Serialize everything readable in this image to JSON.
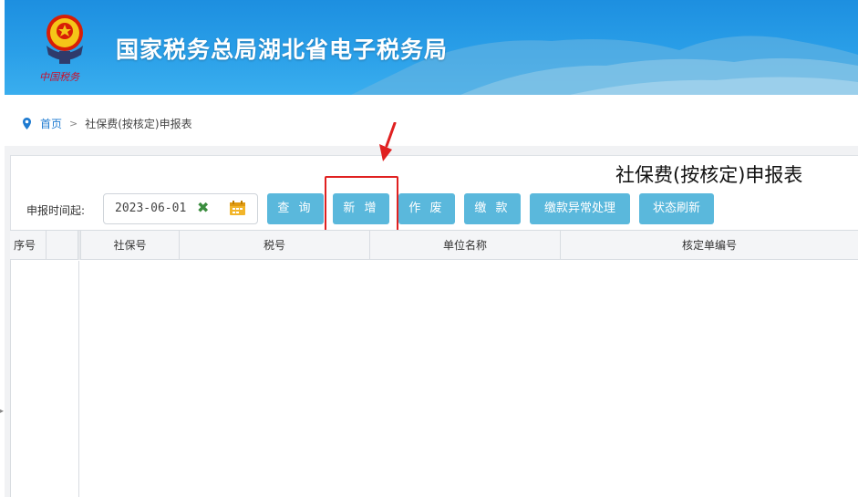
{
  "header": {
    "site_title": "国家税务总局湖北省电子税务局",
    "slogan": "中国税务"
  },
  "breadcrumb": {
    "home": "首页",
    "separator": ">",
    "current": "社保费(按核定)申报表"
  },
  "form": {
    "title": "社保费(按核定)申报表",
    "date_label": "申报时间起:",
    "date_value": "2023-06-01"
  },
  "toolbar": {
    "query": "查 询",
    "add": "新 增",
    "void": "作 废",
    "pay": "缴 款",
    "payment_exception": "缴款异常处理",
    "status_refresh": "状态刷新"
  },
  "table": {
    "columns": [
      "序号",
      "",
      "社保号",
      "税号",
      "单位名称",
      "核定单编号"
    ],
    "rows": []
  },
  "colors": {
    "button_bg": "#5ab8dc",
    "highlight": "#e02020",
    "link": "#1e7bd1",
    "banner": "#2a9fe8"
  },
  "icons": {
    "clear": "close-icon",
    "calendar": "calendar-icon",
    "breadcrumb": "location-pin-icon"
  }
}
